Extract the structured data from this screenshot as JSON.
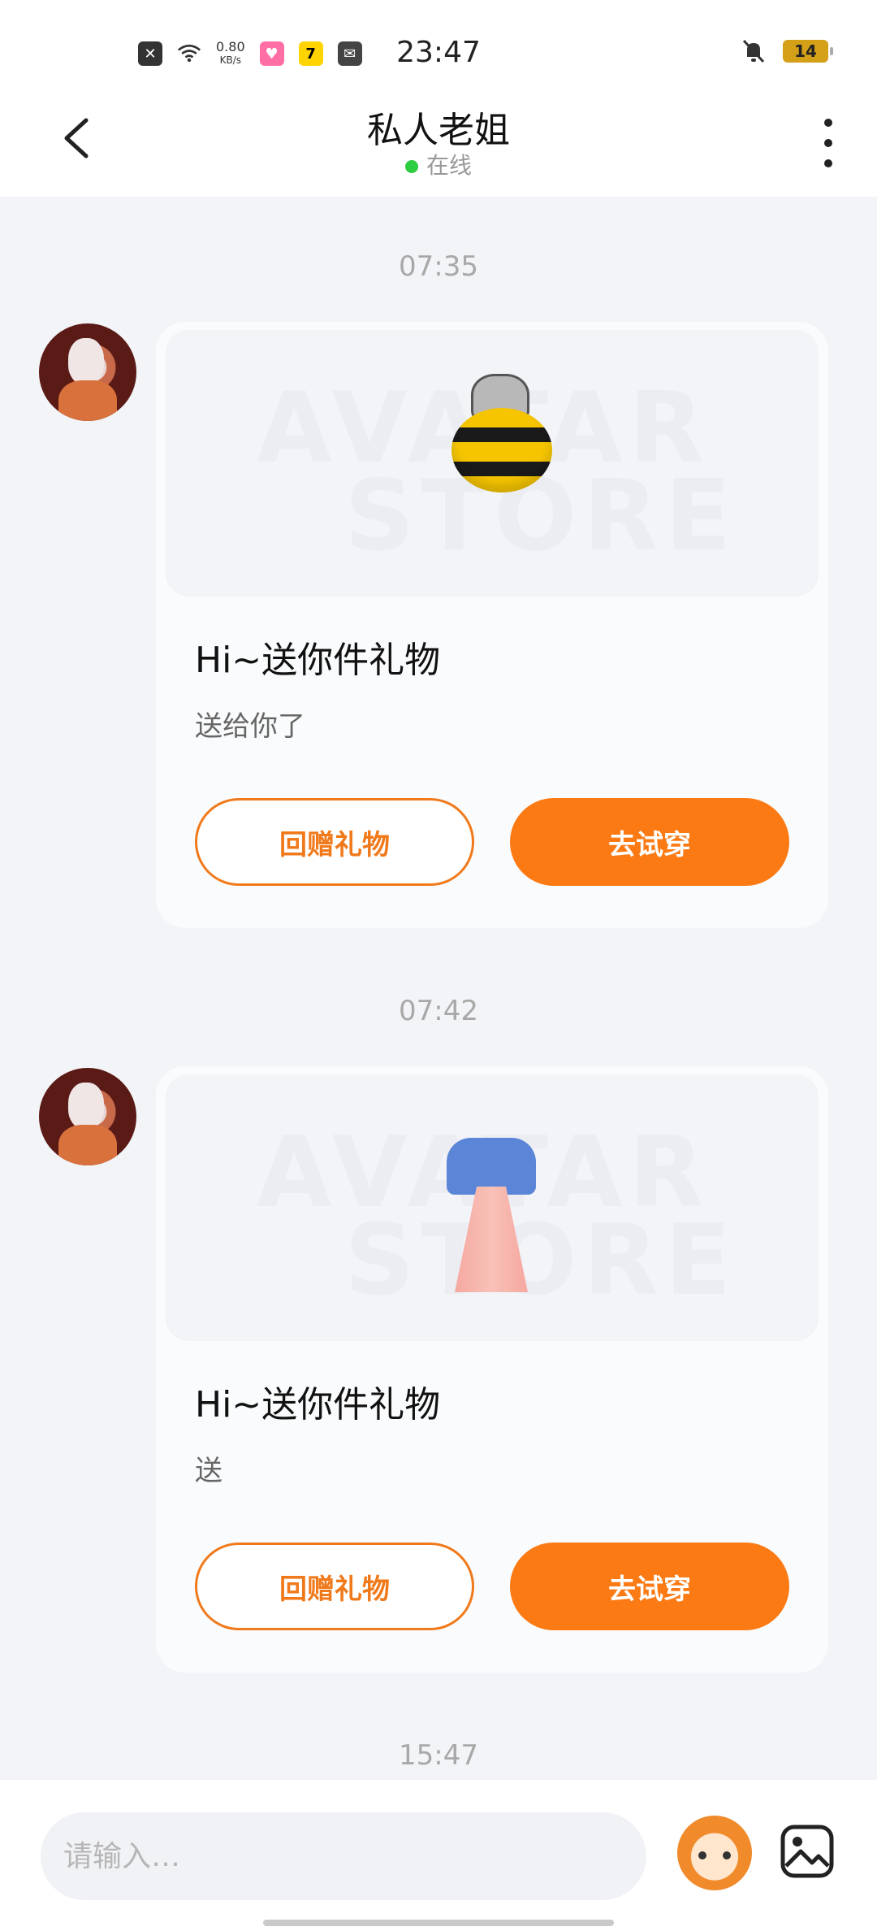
{
  "status_bar": {
    "time": "23:47",
    "speed_value": "0.80",
    "speed_unit": "KB/s",
    "battery": "14"
  },
  "header": {
    "title": "私人老姐",
    "status": "在线"
  },
  "messages": [
    {
      "timestamp": "07:35",
      "title": "Hi~送你件礼物",
      "subtitle": "送给你了",
      "return_gift_label": "回赠礼物",
      "try_on_label": "去试穿",
      "watermark_line1": "AVATAR",
      "watermark_line2": "STORE"
    },
    {
      "timestamp": "07:42",
      "title": "Hi~送你件礼物",
      "subtitle": "送",
      "return_gift_label": "回赠礼物",
      "try_on_label": "去试穿",
      "watermark_line1": "AVATAR",
      "watermark_line2": "STORE"
    }
  ],
  "next_timestamp": "15:47",
  "input": {
    "placeholder": "请输入…"
  }
}
